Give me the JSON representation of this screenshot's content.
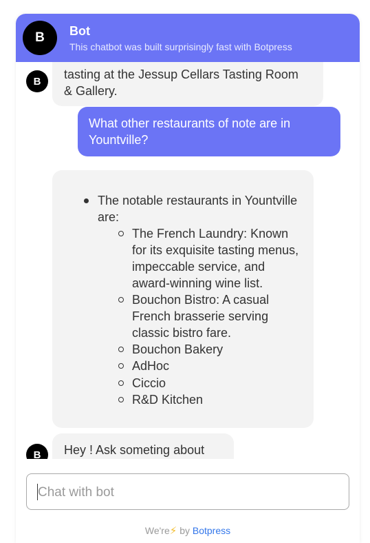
{
  "header": {
    "avatar_initial": "B",
    "title": "Bot",
    "subtitle": "This chatbot was built surprisingly fast with Botpress"
  },
  "messages": [
    {
      "from": "bot",
      "avatar_initial": "B",
      "text": "tasting at the Jessup Cellars Tasting Room & Gallery."
    },
    {
      "from": "user",
      "text": "What other restaurants of note are in Yountville?"
    },
    {
      "from": "bot",
      "intro": "The notable restaurants in Yountville are:",
      "items": [
        "The French Laundry: Known for its exquisite tasting menus, impeccable service, and award-winning wine list.",
        "Bouchon Bistro: A casual French brasserie serving classic bistro fare.",
        "Bouchon Bakery",
        "AdHoc",
        "Ciccio",
        "R&D Kitchen"
      ]
    },
    {
      "from": "bot",
      "avatar_initial": "B",
      "text": "Hey ! Ask someting about Wine!"
    }
  ],
  "composer": {
    "placeholder": "Chat with bot",
    "value": ""
  },
  "footer": {
    "prefix": "We're",
    "bolt": "⚡",
    "by": "by",
    "brand": "Botpress"
  },
  "colors": {
    "accent": "#6b74f5",
    "bot_bubble": "#f3f3f3",
    "brand_link": "#3276ea"
  }
}
